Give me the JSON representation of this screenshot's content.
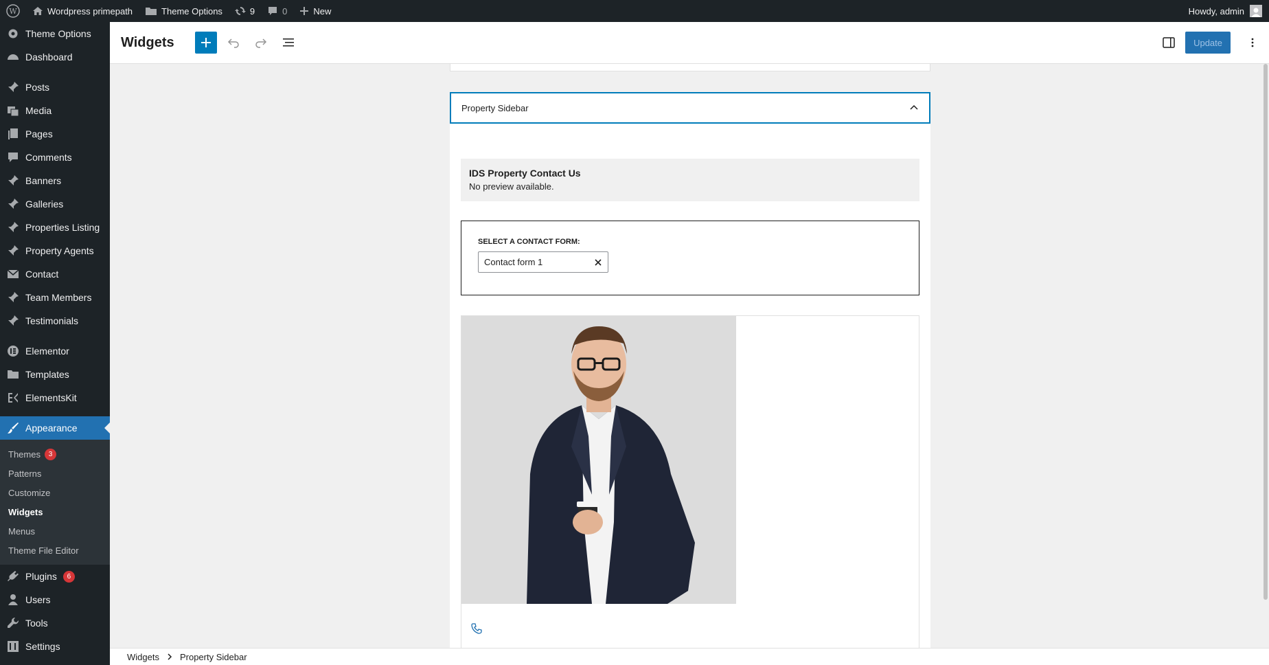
{
  "adminbar": {
    "site_name": "Wordpress primepath",
    "theme_options": "Theme Options",
    "updates_count": "9",
    "comments_count": "0",
    "new_label": "New",
    "howdy": "Howdy, admin"
  },
  "menu": {
    "theme_options": "Theme Options",
    "dashboard": "Dashboard",
    "posts": "Posts",
    "media": "Media",
    "pages": "Pages",
    "comments": "Comments",
    "banners": "Banners",
    "galleries": "Galleries",
    "properties_listing": "Properties Listing",
    "property_agents": "Property Agents",
    "contact": "Contact",
    "team_members": "Team Members",
    "testimonials": "Testimonials",
    "elementor": "Elementor",
    "templates": "Templates",
    "elementskit": "ElementsKit",
    "appearance": "Appearance",
    "plugins": "Plugins",
    "plugins_badge": "6",
    "users": "Users",
    "tools": "Tools",
    "settings": "Settings"
  },
  "submenu": {
    "themes": "Themes",
    "themes_badge": "3",
    "patterns": "Patterns",
    "customize": "Customize",
    "widgets": "Widgets",
    "menus": "Menus",
    "theme_file_editor": "Theme File Editor"
  },
  "header": {
    "title": "Widgets",
    "update_label": "Update"
  },
  "widget_area": {
    "name": "Property Sidebar",
    "legacy_title": "IDS Property Contact Us",
    "legacy_note": "No preview available.",
    "form_label": "Select a contact form:",
    "selected_form": "Contact form 1"
  },
  "breadcrumb": {
    "root": "Widgets",
    "current": "Property Sidebar"
  },
  "colors": {
    "admin_dark": "#1d2327",
    "accent_blue": "#2271b1",
    "badge_red": "#d63638"
  }
}
